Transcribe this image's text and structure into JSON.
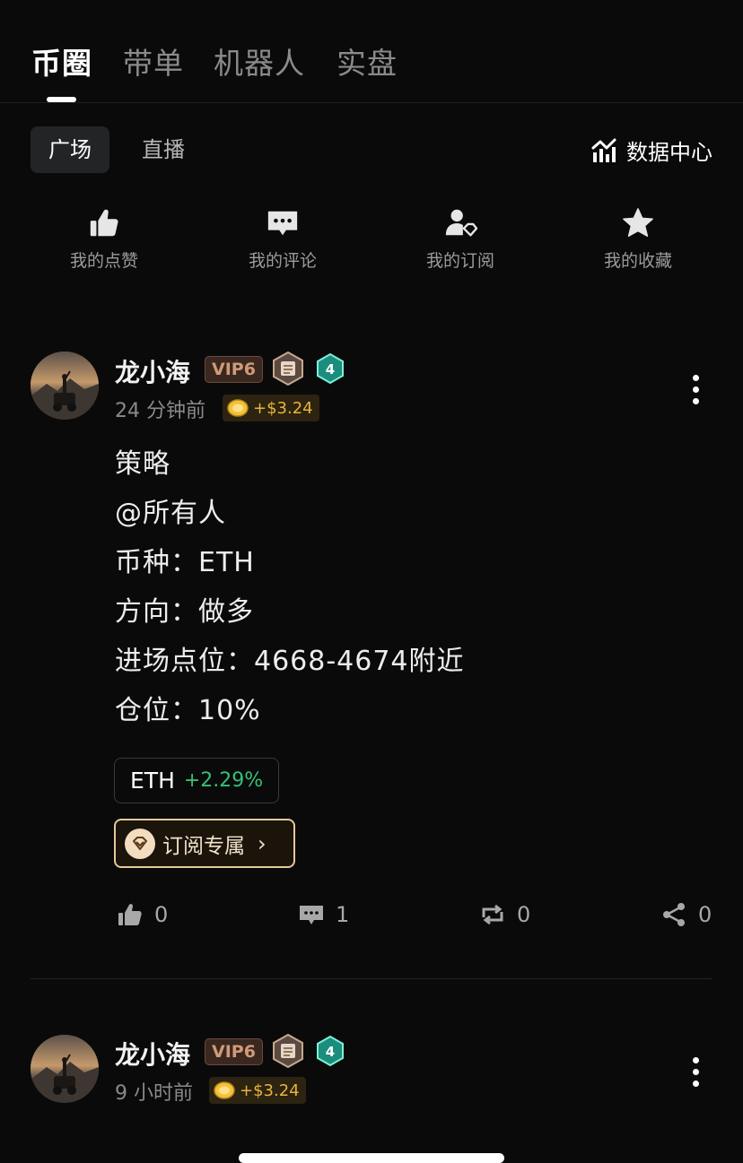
{
  "top_tabs": [
    {
      "label": "币圈"
    },
    {
      "label": "带单"
    },
    {
      "label": "机器人"
    },
    {
      "label": "实盘"
    }
  ],
  "sub_tabs": [
    {
      "label": "广场"
    },
    {
      "label": "直播"
    }
  ],
  "data_center_label": "数据中心",
  "quick_actions": [
    {
      "label": "我的点赞",
      "icon": "thumbs-up-icon"
    },
    {
      "label": "我的评论",
      "icon": "comment-icon"
    },
    {
      "label": "我的订阅",
      "icon": "subscription-icon"
    },
    {
      "label": "我的收藏",
      "icon": "star-icon"
    }
  ],
  "posts": [
    {
      "author": "龙小海",
      "vip": "VIP6",
      "level": "4",
      "time": "24 分钟前",
      "reward": "+$3.24",
      "lines": [
        "策略",
        "@所有人",
        "币种：ETH",
        "方向：做多",
        "进场点位：4668-4674附近",
        "仓位：10%"
      ],
      "coin_symbol": "ETH",
      "coin_change": "+2.29%",
      "subscribe_label": "订阅专属",
      "likes": "0",
      "comments": "1",
      "reposts": "0",
      "shares": "0"
    },
    {
      "author": "龙小海",
      "vip": "VIP6",
      "level": "4",
      "time": "9 小时前",
      "reward": "+$3.24"
    }
  ],
  "colors": {
    "background": "#0a0a0a",
    "positive": "#35c074",
    "gold": "#e9b43a",
    "vip_text": "#d09a78"
  }
}
